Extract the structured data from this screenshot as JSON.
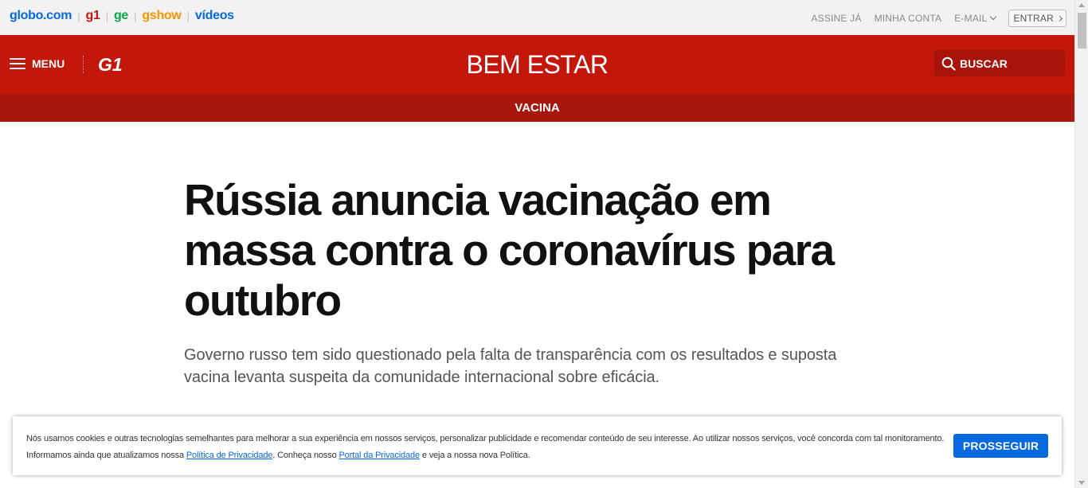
{
  "globo_bar": {
    "links": {
      "globo": "globo.com",
      "g1": "g1",
      "ge": "ge",
      "gshow": "gshow",
      "videos": "vídeos"
    },
    "brand_colors": {
      "globo": "#0669de",
      "g1": "#c4170c",
      "ge": "#06aa48",
      "gshow": "#fa9400",
      "videos": "#0669de"
    },
    "account": {
      "subscribe": "ASSINE JÁ",
      "my_account": "MINHA CONTA",
      "email": "E-MAIL",
      "login": "ENTRAR"
    }
  },
  "header": {
    "menu_label": "MENU",
    "logo_text": "G1",
    "section_title": "BEM ESTAR",
    "search_label": "BUSCAR",
    "accent_color": "#c4170c"
  },
  "sub_header": {
    "label": "VACINA"
  },
  "article": {
    "headline": "Rússia anuncia vacinação em massa contra o coronavírus para outubro",
    "subtitle": "Governo russo tem sido questionado pela falta de transparência com os resultados e suposta vacina levanta suspeita da comunidade internacional sobre eficácia."
  },
  "cookie_banner": {
    "text_1": "Nós usamos cookies e outras tecnologias semelhantes para melhorar a sua experiência em nossos serviços, personalizar publicidade e recomendar conteúdo de seu interesse. Ao utilizar nossos serviços, você concorda com tal monitoramento. Informamos ainda que atualizamos nossa ",
    "privacy_policy_link": "Política de Privacidade",
    "text_2": ". Conheça nosso ",
    "privacy_portal_link": "Portal da Privacidade",
    "text_3": " e veja a nossa nova Política.",
    "proceed_button": "PROSSEGUIR"
  }
}
